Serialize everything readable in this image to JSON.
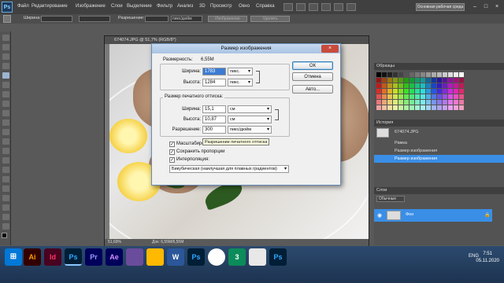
{
  "menubar": {
    "logo": "Ps",
    "items": [
      "Файл",
      "Редактирование",
      "Изображение",
      "Слои",
      "Выделение",
      "Фильтр",
      "Анализ",
      "3D",
      "Просмотр",
      "Окно",
      "Справка"
    ],
    "workspace_button": "Основная рабочая среда",
    "win_controls": [
      "–",
      "□",
      "×"
    ]
  },
  "optionsbar": {
    "width_label": "Ширина:",
    "resolution_label": "Разрешение:",
    "unit_value": "пикс/дюйм",
    "image_button": "Изображение",
    "delete_button": "Удалить"
  },
  "document": {
    "title": "674074.JPG @ 51,7% (RGB/8*)",
    "zoom": "51,69%",
    "doc_info": "Док: 6,55M/6,55M"
  },
  "dialog": {
    "title": "Размер изображения",
    "close": "×",
    "dimensions_label": "Размерность:",
    "dimensions_value": "6,55M",
    "pixel": {
      "width_label": "Ширина:",
      "width_value": "1783",
      "width_unit": "пикс.",
      "height_label": "Высота:",
      "height_value": "1284",
      "height_unit": "пикс."
    },
    "print_group_label": "Размер печатного оттиска:",
    "print": {
      "width_label": "Ширина:",
      "width_value": "15,1",
      "width_unit": "см",
      "height_label": "Высота:",
      "height_value": "10,87",
      "height_unit": "см",
      "resolution_label": "Разрешение:",
      "resolution_value": "300",
      "resolution_unit": "пикс/дюйм"
    },
    "tooltip": "Разрешение печатного оттиска",
    "checkboxes": [
      {
        "label": "Масштабировать стили",
        "checked": true
      },
      {
        "label": "Сохранить пропорции",
        "checked": true
      },
      {
        "label": "Интерполяция:",
        "checked": true
      }
    ],
    "interpolation_value": "Бикубическая (наилучшая для плавных градиентов)",
    "ok_button": "ОК",
    "cancel_button": "Отмена",
    "auto_button": "Авто..."
  },
  "panels": {
    "swatches_title": "Образцы",
    "history_title": "История",
    "history_file": "674074.JPG",
    "history_items": [
      "Рамка",
      "Размер изображения",
      "Размер изображения"
    ],
    "layers_title": "Слои",
    "layers_mode": "Обычные",
    "layer_name": "Фон"
  },
  "taskbar": {
    "apps": [
      "Ai",
      "Id",
      "Ps",
      "Pr",
      "Ae",
      "",
      "",
      "W",
      "Ps",
      "",
      "3",
      "",
      "Ps"
    ],
    "lang": "ENG",
    "time": "7:51",
    "date": "05.11.2020"
  },
  "colors": {
    "dialog_title_bg": "#b7cde9",
    "selection": "#3a8ee6",
    "photoshop_blue": "#31a8ff"
  }
}
